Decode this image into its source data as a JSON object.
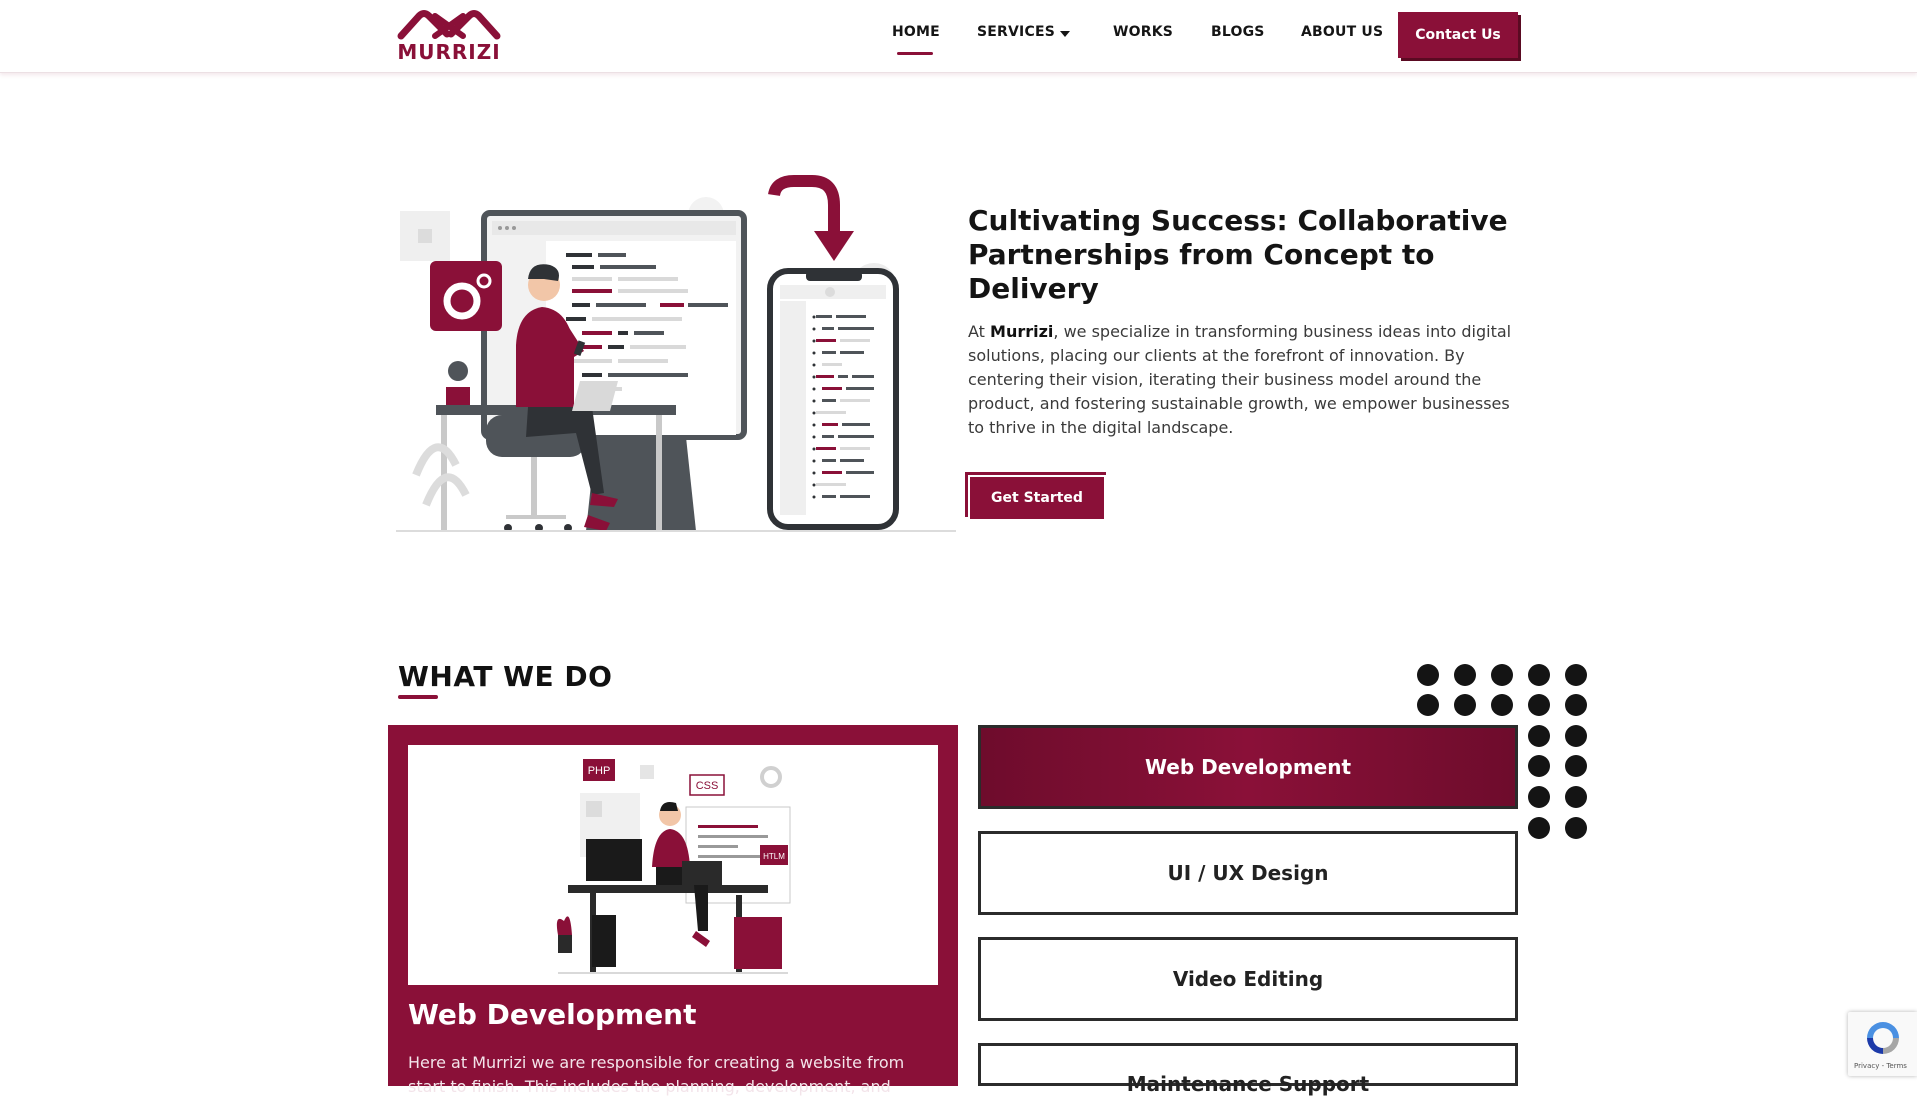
{
  "header": {
    "logo_text": "MURRIZI",
    "nav": [
      {
        "label": "HOME"
      },
      {
        "label": "SERVICES"
      },
      {
        "label": "WORKS"
      },
      {
        "label": "BLOGS"
      },
      {
        "label": "ABOUT US"
      }
    ],
    "contact_label": "Contact Us"
  },
  "hero": {
    "title": "Cultivating Success: Collaborative Partnerships from Concept to Delivery",
    "text_prefix": "At ",
    "text_brand": "Murrizi",
    "text_body": ", we specialize in transforming business ideas into digital solutions, placing our clients at the forefront of innovation. By centering their vision, iterating their business model around the product, and fostering sustainable growth, we empower businesses to thrive in the digital landscape.",
    "cta_label": "Get Started"
  },
  "what_we_do": {
    "title": "WHAT WE DO",
    "card": {
      "title": "Web Development",
      "text": "Here at Murrizi we are responsible for creating a website from start to finish. This includes the planning, development, and",
      "image_tags": {
        "php": "PHP",
        "css": "CSS",
        "htlm": "HTLM"
      }
    },
    "services": [
      {
        "label": "Web Development"
      },
      {
        "label": "UI / UX Design"
      },
      {
        "label": "Video Editing"
      },
      {
        "label": "Maintenance Support"
      }
    ]
  },
  "recaptcha": {
    "text": "Privacy - Terms"
  },
  "colors": {
    "brand": "#8a1038",
    "text": "#141414"
  },
  "icons": [
    "logo-mark-icon",
    "dropdown-caret-icon",
    "gear-icon",
    "recaptcha-icon"
  ]
}
